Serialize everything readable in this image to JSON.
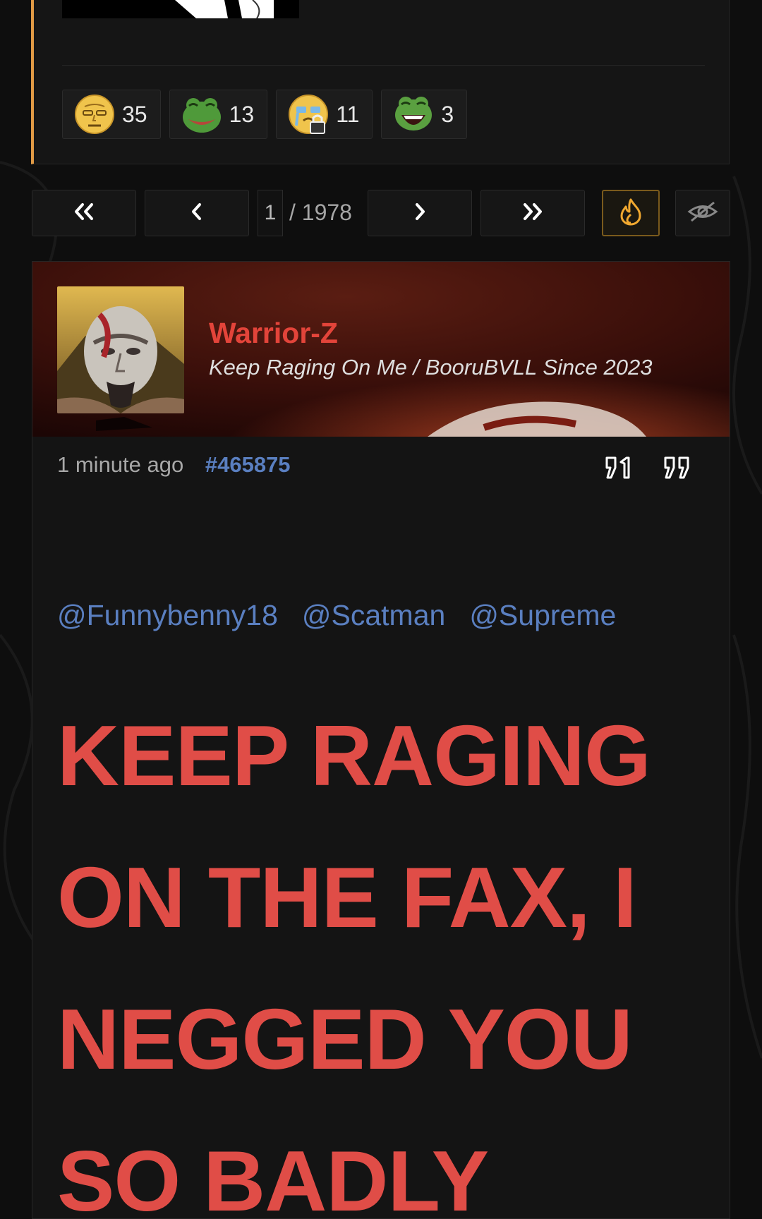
{
  "reactions": [
    {
      "icon": "stern-face-emoji-icon",
      "count": "35"
    },
    {
      "icon": "smiling-frog-emoji-icon",
      "count": "13"
    },
    {
      "icon": "crying-locked-face-emoji-icon",
      "count": "11"
    },
    {
      "icon": "laughing-frog-emoji-icon",
      "count": "3"
    }
  ],
  "pagination": {
    "first_icon": "double-chevron-left-icon",
    "prev_icon": "chevron-left-icon",
    "current_page": "1",
    "total_label": "/ 1978",
    "next_icon": "chevron-right-icon",
    "last_icon": "double-chevron-right-icon",
    "hot_icon": "flame-icon",
    "hide_icon": "eye-off-icon"
  },
  "post": {
    "username": "Warrior-Z",
    "tagline": "Keep Raging On Me / BooruBVLL Since 2023",
    "time": "1 minute ago",
    "post_number": "#465875",
    "mentions": [
      "@Funnybenny18",
      "@Scatman",
      "@Supreme"
    ],
    "body_lines": [
      "KEEP RAGING",
      "ON THE FAX, I",
      "NEGGED YOU",
      "SO BADLY"
    ]
  },
  "colors": {
    "accent": "#e09a45",
    "username": "#e3443a",
    "link": "#5a7fc0",
    "big_text": "#e04d47",
    "background": "#0e0e0e"
  }
}
